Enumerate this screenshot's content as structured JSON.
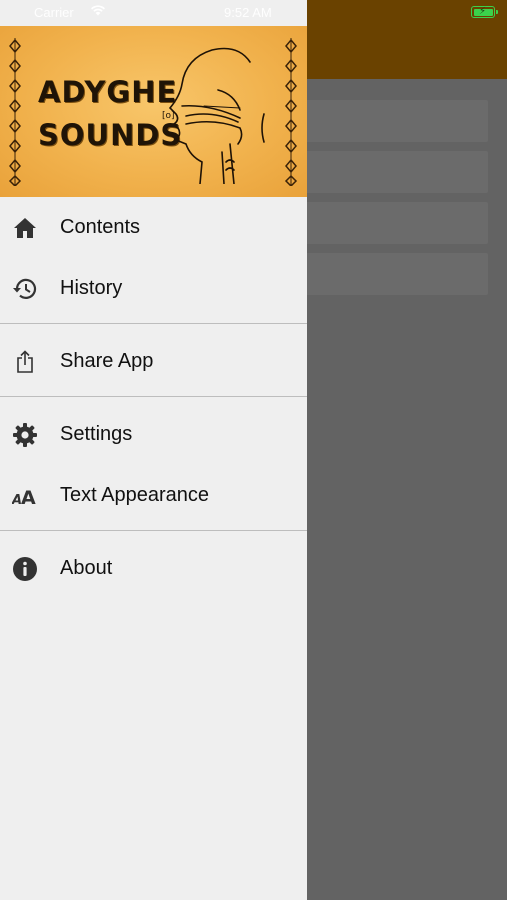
{
  "status_bar": {
    "carrier": "Carrier",
    "time": "9:52 AM",
    "wifi_icon": "wifi-icon",
    "battery_icon": "battery-charging-icon",
    "battery_color": "#3bd24b"
  },
  "header": {
    "title_line1": "ADYGHE",
    "title_line2": "SOUNDS",
    "background_color": "#f1b24d",
    "illustration": "vocal-tract-profile-illustration",
    "illustration_label": "[o]"
  },
  "menu": {
    "groups": [
      [
        {
          "label": "Contents",
          "icon": "home-icon"
        },
        {
          "label": "History",
          "icon": "history-icon"
        }
      ],
      [
        {
          "label": "Share App",
          "icon": "share-icon"
        }
      ],
      [
        {
          "label": "Settings",
          "icon": "gear-icon"
        },
        {
          "label": "Text Appearance",
          "icon": "text-size-icon"
        }
      ],
      [
        {
          "label": "About",
          "icon": "info-icon"
        }
      ]
    ]
  },
  "colors": {
    "drawer_bg": "#efefef",
    "background_nav": "#6a4200",
    "overlay": "#636363"
  }
}
